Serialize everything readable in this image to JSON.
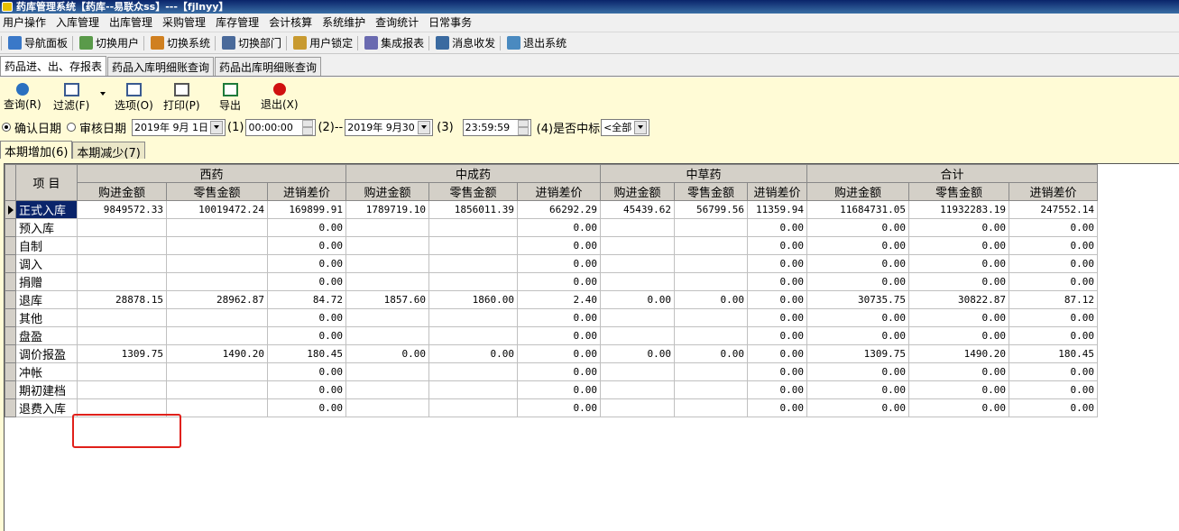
{
  "window": {
    "title": "药库管理系统【药库--易联众ss】---【fjlnyy】"
  },
  "menu": [
    "用户操作",
    "入库管理",
    "出库管理",
    "采购管理",
    "库存管理",
    "会计核算",
    "系统维护",
    "查询统计",
    "日常事务"
  ],
  "toolbar1": [
    {
      "label": "导航面板",
      "icon": "navigation-panel-icon",
      "color": "#3a78c8"
    },
    {
      "label": "切换用户",
      "icon": "switch-user-icon",
      "color": "#5a9a4a"
    },
    {
      "label": "切换系统",
      "icon": "switch-system-icon",
      "color": "#d08020"
    },
    {
      "label": "切换部门",
      "icon": "switch-department-icon",
      "color": "#4a6a9a"
    },
    {
      "label": "用户锁定",
      "icon": "user-lock-icon",
      "color": "#c89a30"
    },
    {
      "label": "集成报表",
      "icon": "integrated-report-icon",
      "color": "#6a6ab0"
    },
    {
      "label": "消息收发",
      "icon": "message-icon",
      "color": "#3a6aa0"
    },
    {
      "label": "退出系统",
      "icon": "exit-system-icon",
      "color": "#4a8ac0"
    }
  ],
  "tabs": [
    "药品进、出、存报表",
    "药品入库明细账查询",
    "药品出库明细账查询"
  ],
  "toolbar2": [
    {
      "label": "查询(R)",
      "icon": "refresh-query-icon",
      "color": "#2a70c0"
    },
    {
      "label": "过滤(F)",
      "icon": "filter-icon",
      "color": "#3a5a90"
    },
    {
      "label": "选项(O)",
      "icon": "options-icon",
      "color": "#3a5a90"
    },
    {
      "label": "打印(P)",
      "icon": "printer-icon",
      "color": "#555555"
    },
    {
      "label": "导出",
      "icon": "excel-export-icon",
      "color": "#1e7a3a"
    },
    {
      "label": "退出(X)",
      "icon": "power-exit-icon",
      "color": "#d01010"
    }
  ],
  "filter": {
    "radio_confirm": "确认日期",
    "radio_audit": "审核日期",
    "date_from": "2019年 9月 1日",
    "marker1": "(1)",
    "time_from": "00:00:00",
    "marker2": "(2)--",
    "date_to": "2019年 9月30日",
    "marker3": "(3)",
    "time_to": "23:59:59",
    "marker4": "(4)是否中标",
    "bid_select": "<全部"
  },
  "subtabs": [
    "本期增加(6)",
    "本期减少(7)"
  ],
  "grid": {
    "item_header": "项  目",
    "groups": [
      "西药",
      "中成药",
      "中草药",
      "合计"
    ],
    "subheaders": [
      "购进金额",
      "零售金额",
      "进销差价",
      "购进金额",
      "零售金额",
      "进销差价",
      "购进金额",
      "零售金额",
      "进销差价",
      "购进金额",
      "零售金额",
      "进销差价"
    ],
    "rows": [
      {
        "name": "正式入库",
        "cells": [
          "9849572.33",
          "10019472.24",
          "169899.91",
          "1789719.10",
          "1856011.39",
          "66292.29",
          "45439.62",
          "56799.56",
          "11359.94",
          "11684731.05",
          "11932283.19",
          "247552.14"
        ]
      },
      {
        "name": "预入库",
        "cells": [
          "",
          "",
          "0.00",
          "",
          "",
          "0.00",
          "",
          "",
          "0.00",
          "0.00",
          "0.00",
          "0.00"
        ]
      },
      {
        "name": "自制",
        "cells": [
          "",
          "",
          "0.00",
          "",
          "",
          "0.00",
          "",
          "",
          "0.00",
          "0.00",
          "0.00",
          "0.00"
        ]
      },
      {
        "name": "调入",
        "cells": [
          "",
          "",
          "0.00",
          "",
          "",
          "0.00",
          "",
          "",
          "0.00",
          "0.00",
          "0.00",
          "0.00"
        ]
      },
      {
        "name": "捐赠",
        "cells": [
          "",
          "",
          "0.00",
          "",
          "",
          "0.00",
          "",
          "",
          "0.00",
          "0.00",
          "0.00",
          "0.00"
        ]
      },
      {
        "name": "退库",
        "cells": [
          "28878.15",
          "28962.87",
          "84.72",
          "1857.60",
          "1860.00",
          "2.40",
          "0.00",
          "0.00",
          "0.00",
          "30735.75",
          "30822.87",
          "87.12"
        ]
      },
      {
        "name": "其他",
        "cells": [
          "",
          "",
          "0.00",
          "",
          "",
          "0.00",
          "",
          "",
          "0.00",
          "0.00",
          "0.00",
          "0.00"
        ]
      },
      {
        "name": "盘盈",
        "cells": [
          "",
          "",
          "0.00",
          "",
          "",
          "0.00",
          "",
          "",
          "0.00",
          "0.00",
          "0.00",
          "0.00"
        ]
      },
      {
        "name": "调价报盈",
        "cells": [
          "1309.75",
          "1490.20",
          "180.45",
          "0.00",
          "0.00",
          "0.00",
          "0.00",
          "0.00",
          "0.00",
          "1309.75",
          "1490.20",
          "180.45"
        ]
      },
      {
        "name": "冲帐",
        "cells": [
          "",
          "",
          "0.00",
          "",
          "",
          "0.00",
          "",
          "",
          "0.00",
          "0.00",
          "0.00",
          "0.00"
        ]
      },
      {
        "name": "期初建档",
        "cells": [
          "",
          "",
          "0.00",
          "",
          "",
          "0.00",
          "",
          "",
          "0.00",
          "0.00",
          "0.00",
          "0.00"
        ]
      },
      {
        "name": "退费入库",
        "cells": [
          "",
          "",
          "0.00",
          "",
          "",
          "0.00",
          "",
          "",
          "0.00",
          "0.00",
          "0.00",
          "0.00"
        ]
      }
    ]
  },
  "highlight_color": "#e0201a"
}
